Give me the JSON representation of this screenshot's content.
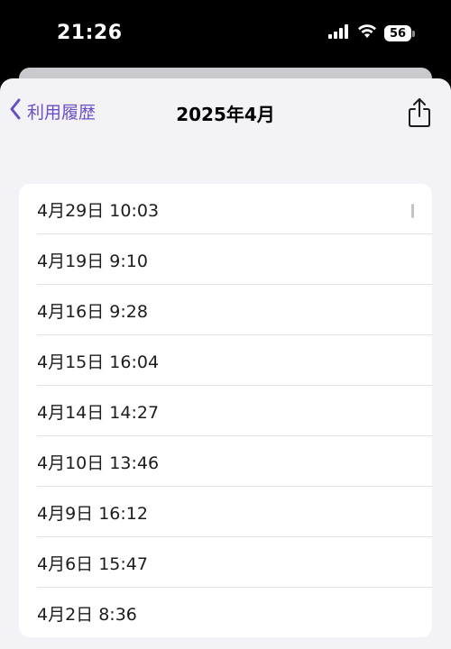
{
  "status_bar": {
    "time": "21:26",
    "battery": "56",
    "icons": [
      "cellular-signal-icon",
      "wifi-icon",
      "battery-icon"
    ]
  },
  "nav": {
    "back_label": "利用履歴",
    "title": "2025年4月",
    "share_icon": "share-icon"
  },
  "history": {
    "items": [
      {
        "label": "4月29日 10:03"
      },
      {
        "label": "4月19日 9:10"
      },
      {
        "label": "4月16日 9:28"
      },
      {
        "label": "4月15日 16:04"
      },
      {
        "label": "4月14日 14:27"
      },
      {
        "label": "4月10日 13:46"
      },
      {
        "label": "4月9日 16:12"
      },
      {
        "label": "4月6日 15:47"
      },
      {
        "label": "4月2日 8:36"
      }
    ]
  },
  "colors": {
    "accent": "#6a4fc4",
    "background": "#f2f2f7",
    "card": "#ffffff"
  }
}
